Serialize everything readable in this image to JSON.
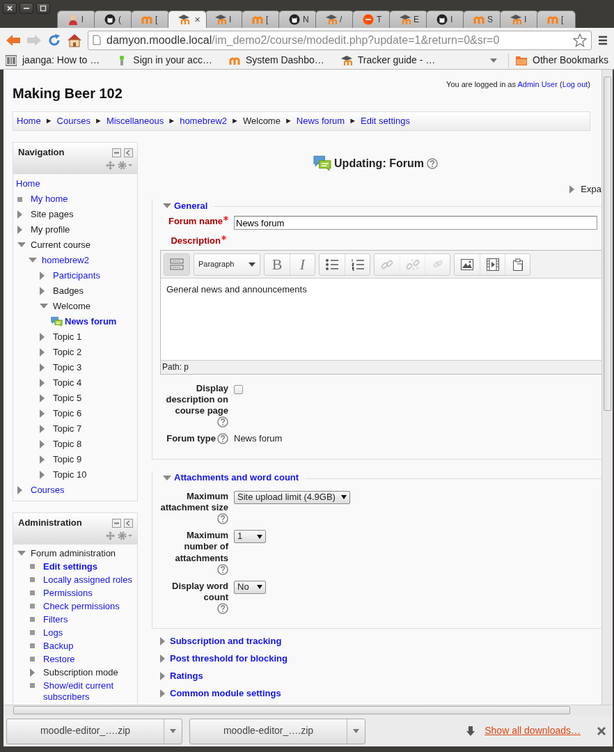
{
  "browser": {
    "tabs": [
      {
        "kind": "person",
        "label": "l",
        "selected": false
      },
      {
        "kind": "github",
        "label": "(",
        "selected": false
      },
      {
        "kind": "moodle",
        "label": "[",
        "selected": false
      },
      {
        "kind": "hat",
        "close": "×",
        "selected": true
      },
      {
        "kind": "hat",
        "label": "I",
        "selected": false
      },
      {
        "kind": "moodle",
        "label": "[",
        "selected": false
      },
      {
        "kind": "github",
        "label": "N",
        "selected": false
      },
      {
        "kind": "hat",
        "label": "/",
        "selected": false
      },
      {
        "kind": "ars",
        "label": "T",
        "selected": false
      },
      {
        "kind": "hat",
        "label": "E",
        "selected": false
      },
      {
        "kind": "github",
        "label": "I",
        "selected": false
      },
      {
        "kind": "moodle",
        "label": "S",
        "selected": false
      },
      {
        "kind": "hat",
        "label": "I",
        "selected": false
      },
      {
        "kind": "moodle",
        "label": "[",
        "selected": false
      }
    ],
    "address": {
      "host": "damyon.moodle.local",
      "path": "/im_demo2/course/modedit.php?update=1&return=0&sr=0"
    },
    "bookmarks": [
      {
        "kind": "stripes",
        "label": "jaanga: How to …"
      },
      {
        "kind": "stick",
        "label": "Sign in your acc…"
      },
      {
        "kind": "moodle",
        "label": "System Dashbo…"
      },
      {
        "kind": "hat",
        "label": "Tracker guide - …"
      }
    ],
    "other_bookmarks": "Other Bookmarks"
  },
  "header": {
    "title": "Making Beer 102",
    "login": [
      {
        "text": "You are logged in as ",
        "link": false
      },
      {
        "text": "Admin User",
        "link": true
      },
      {
        "text": " (",
        "link": false
      },
      {
        "text": "Log out",
        "link": true
      },
      {
        "text": ")",
        "link": false
      }
    ]
  },
  "breadcrumb": [
    {
      "label": "Home",
      "link": true,
      "separator": "►"
    },
    {
      "label": "Courses",
      "link": true,
      "separator": "►"
    },
    {
      "label": "Miscellaneous",
      "link": true,
      "separator": "►"
    },
    {
      "label": "homebrew2",
      "link": true,
      "separator": "►"
    },
    {
      "label": "Welcome",
      "link": false,
      "separator": "►"
    },
    {
      "label": "News forum",
      "link": true,
      "separator": "►"
    },
    {
      "label": "Edit settings",
      "link": true
    }
  ],
  "navigation": {
    "title": "Navigation",
    "items": [
      {
        "kind": "root",
        "label": "Home",
        "link": true,
        "current": false
      },
      {
        "kind": "leaf",
        "label": "My home",
        "link": true,
        "current": false
      },
      {
        "kind": "branch",
        "label": "Site pages",
        "link": false,
        "current": false,
        "expanded": false
      },
      {
        "kind": "branch",
        "label": "My profile",
        "link": false,
        "current": false,
        "expanded": false
      },
      {
        "kind": "branch",
        "label": "Current course",
        "link": false,
        "current": false,
        "expanded": true,
        "children": [
          {
            "kind": "branch",
            "label": "homebrew2",
            "link": true,
            "current": false,
            "expanded": true,
            "children": [
              {
                "kind": "branch",
                "label": "Participants",
                "link": true,
                "current": false,
                "expanded": false
              },
              {
                "kind": "branch",
                "label": "Badges",
                "link": false,
                "current": false,
                "expanded": false
              },
              {
                "kind": "branch",
                "label": "Welcome",
                "link": false,
                "current": false,
                "expanded": true,
                "children": [
                  {
                    "kind": "forum",
                    "label": "News forum",
                    "link": true,
                    "current": true
                  }
                ]
              },
              {
                "kind": "branch",
                "label": "Topic 1",
                "link": false,
                "current": false,
                "expanded": false
              },
              {
                "kind": "branch",
                "label": "Topic 2",
                "link": false,
                "current": false,
                "expanded": false
              },
              {
                "kind": "branch",
                "label": "Topic 3",
                "link": false,
                "current": false,
                "expanded": false
              },
              {
                "kind": "branch",
                "label": "Topic 4",
                "link": false,
                "current": false,
                "expanded": false
              },
              {
                "kind": "branch",
                "label": "Topic 5",
                "link": false,
                "current": false,
                "expanded": false
              },
              {
                "kind": "branch",
                "label": "Topic 6",
                "link": false,
                "current": false,
                "expanded": false
              },
              {
                "kind": "branch",
                "label": "Topic 7",
                "link": false,
                "current": false,
                "expanded": false
              },
              {
                "kind": "branch",
                "label": "Topic 8",
                "link": false,
                "current": false,
                "expanded": false
              },
              {
                "kind": "branch",
                "label": "Topic 9",
                "link": false,
                "current": false,
                "expanded": false
              },
              {
                "kind": "branch",
                "label": "Topic 10",
                "link": false,
                "current": false,
                "expanded": false
              }
            ]
          }
        ]
      },
      {
        "kind": "branch",
        "label": "Courses",
        "link": true,
        "current": false,
        "expanded": false
      }
    ]
  },
  "administration": {
    "title": "Administration",
    "items": [
      {
        "kind": "branch",
        "label": "Forum administration",
        "link": false,
        "current": false,
        "expanded": true,
        "children": [
          {
            "kind": "leaf",
            "label": "Edit settings",
            "link": true,
            "current": true
          },
          {
            "kind": "leaf",
            "label": "Locally assigned roles",
            "link": true,
            "current": false
          },
          {
            "kind": "leaf",
            "label": "Permissions",
            "link": true,
            "current": false
          },
          {
            "kind": "leaf",
            "label": "Check permissions",
            "link": true,
            "current": false
          },
          {
            "kind": "leaf",
            "label": "Filters",
            "link": true,
            "current": false
          },
          {
            "kind": "leaf",
            "label": "Logs",
            "link": true,
            "current": false
          },
          {
            "kind": "leaf",
            "label": "Backup",
            "link": true,
            "current": false
          },
          {
            "kind": "leaf",
            "label": "Restore",
            "link": true,
            "current": false
          },
          {
            "kind": "branch",
            "label": "Subscription mode",
            "link": false,
            "current": false,
            "expanded": false
          },
          {
            "kind": "leaf",
            "label": "Show/edit current subscribers",
            "link": true,
            "current": false
          }
        ]
      }
    ]
  },
  "form": {
    "heading": "Updating: Forum",
    "expand_all": "Expa",
    "sections": [
      {
        "title": "General",
        "expanded": true,
        "fields": [
          {
            "kind": "text",
            "label": "Forum name",
            "required": true,
            "help": false,
            "value": "News forum"
          },
          {
            "kind": "editor",
            "label": "Description",
            "required": true,
            "help": false,
            "toolbar": [
              [
                {
                  "kind": "toggle",
                  "pressed": true,
                  "disabled": false
                }
              ],
              [
                {
                  "kind": "format",
                  "label": "Paragraph",
                  "pressed": false,
                  "disabled": false
                }
              ],
              [
                {
                  "kind": "bold",
                  "label": "B",
                  "pressed": false,
                  "disabled": false
                },
                {
                  "kind": "italic",
                  "label": "I",
                  "pressed": false,
                  "disabled": false
                }
              ],
              [
                {
                  "kind": "bullets",
                  "pressed": false,
                  "disabled": false
                },
                {
                  "kind": "numbers",
                  "pressed": false,
                  "disabled": false
                }
              ],
              [
                {
                  "kind": "link",
                  "pressed": false,
                  "disabled": true
                },
                {
                  "kind": "unlink",
                  "pressed": false,
                  "disabled": true
                },
                {
                  "kind": "anchor",
                  "pressed": false,
                  "disabled": true
                }
              ],
              [
                {
                  "kind": "image",
                  "pressed": false,
                  "disabled": false
                },
                {
                  "kind": "media",
                  "pressed": false,
                  "disabled": false
                },
                {
                  "kind": "paste",
                  "pressed": false,
                  "disabled": false
                }
              ]
            ],
            "content": "General news and announcements",
            "path": "Path: p"
          },
          {
            "kind": "checkbox",
            "label": "Display description on course page",
            "required": false,
            "help": true,
            "checked": false
          },
          {
            "kind": "static",
            "label": "Forum type",
            "required": false,
            "help": true,
            "value": "News forum"
          }
        ]
      },
      {
        "title": "Attachments and word count",
        "expanded": true,
        "fields": [
          {
            "kind": "select",
            "label": "Maximum attachment size",
            "required": false,
            "help": true,
            "value": "Site upload limit (4.9GB)"
          },
          {
            "kind": "select",
            "label": "Maximum number of attachments",
            "required": false,
            "help": true,
            "value": "1"
          },
          {
            "kind": "select",
            "label": "Display word count",
            "required": false,
            "help": true,
            "value": "No"
          }
        ]
      },
      {
        "title": "Subscription and tracking",
        "expanded": false
      },
      {
        "title": "Post threshold for blocking",
        "expanded": false
      },
      {
        "title": "Ratings",
        "expanded": false
      },
      {
        "title": "Common module settings",
        "expanded": false
      }
    ]
  },
  "downloads": {
    "items": [
      {
        "file": "moodle-editor_….zip"
      },
      {
        "file": "moodle-editor_….zip"
      }
    ],
    "show_all": "Show all downloads…"
  }
}
